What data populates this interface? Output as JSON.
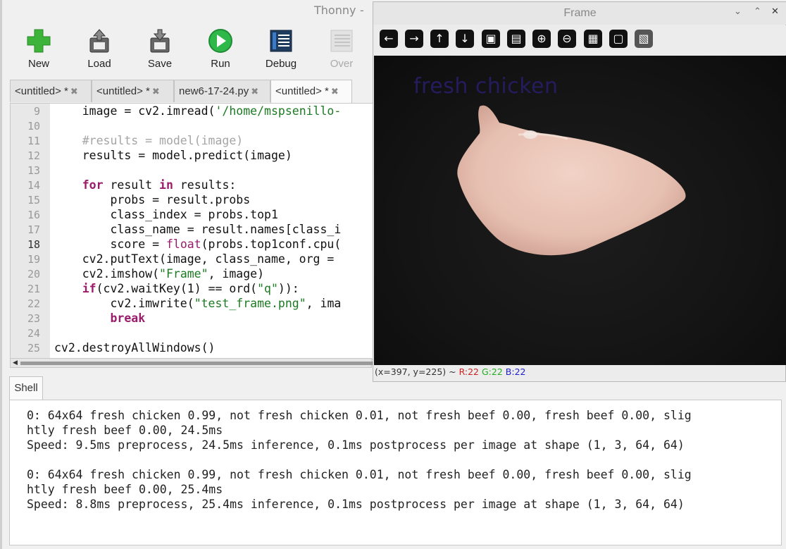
{
  "thonny": {
    "title": "Thonny",
    "title_dash": "-",
    "toolbar": [
      {
        "label": "New",
        "icon": "new-icon"
      },
      {
        "label": "Load",
        "icon": "load-icon"
      },
      {
        "label": "Save",
        "icon": "save-icon"
      },
      {
        "label": "Run",
        "icon": "run-icon"
      },
      {
        "label": "Debug",
        "icon": "debug-icon"
      },
      {
        "label": "Over",
        "icon": "step-over-icon"
      }
    ],
    "tabs": [
      {
        "label": "<untitled> *",
        "close": "✖"
      },
      {
        "label": "<untitled> *",
        "close": "✖"
      },
      {
        "label": "new6-17-24.py",
        "close": "✖"
      },
      {
        "label": "<untitled> *",
        "close": "✖"
      }
    ],
    "editor": {
      "line_numbers": [
        "9",
        "10",
        "11",
        "12",
        "13",
        "14",
        "15",
        "16",
        "17",
        "18",
        "19",
        "20",
        "21",
        "22",
        "23",
        "24",
        "25"
      ],
      "lines": [
        "    image = cv2.imread('/home/mspsenillo-",
        "",
        "    #results = model(image)",
        "    results = model.predict(image)",
        "",
        "    for result in results:",
        "        probs = result.probs",
        "        class_index = probs.top1",
        "        class_name = result.names[class_i",
        "        score = float(probs.top1conf.cpu(",
        "    cv2.putText(image, class_name, org = ",
        "    cv2.imshow(\"Frame\", image)",
        "    if(cv2.waitKey(1) == ord(\"q\")):",
        "        cv2.imwrite(\"test_frame.png\", ima",
        "        break",
        "",
        "cv2.destroyAllWindows()"
      ]
    },
    "shell": {
      "tab_label": "Shell",
      "lines": [
        "0: 64x64 fresh chicken 0.99, not fresh chicken 0.01, not fresh beef 0.00, fresh beef 0.00, slig",
        "htly fresh beef 0.00, 24.5ms",
        "Speed: 9.5ms preprocess, 24.5ms inference, 0.1ms postprocess per image at shape (1, 3, 64, 64)",
        "",
        "0: 64x64 fresh chicken 0.99, not fresh chicken 0.01, not fresh beef 0.00, fresh beef 0.00, slig",
        "htly fresh beef 0.00, 25.4ms",
        "Speed: 8.8ms preprocess, 25.4ms inference, 0.1ms postprocess per image at shape (1, 3, 64, 64)"
      ]
    }
  },
  "frame": {
    "title": "Frame",
    "controls": {
      "minimize": "⌄",
      "maximize": "⌃",
      "close": "✕"
    },
    "toolbar": [
      {
        "glyph": "←",
        "icon": "pan-left-icon"
      },
      {
        "glyph": "→",
        "icon": "pan-right-icon"
      },
      {
        "glyph": "↑",
        "icon": "pan-up-icon"
      },
      {
        "glyph": "↓",
        "icon": "pan-down-icon"
      },
      {
        "glyph": "▣",
        "icon": "zoom-fit-icon"
      },
      {
        "glyph": "▤",
        "icon": "zoom-original-icon"
      },
      {
        "glyph": "⊕",
        "icon": "zoom-in-icon"
      },
      {
        "glyph": "⊖",
        "icon": "zoom-out-icon"
      },
      {
        "glyph": "▦",
        "icon": "save-image-icon"
      },
      {
        "glyph": "▢",
        "icon": "copy-clipboard-icon"
      },
      {
        "glyph": "▧",
        "icon": "properties-icon"
      }
    ],
    "overlay_text": "fresh chicken",
    "status": {
      "coords": "(x=397, y=225) ~ ",
      "r": "R:22",
      "g": "G:22",
      "b": "B:22"
    }
  }
}
